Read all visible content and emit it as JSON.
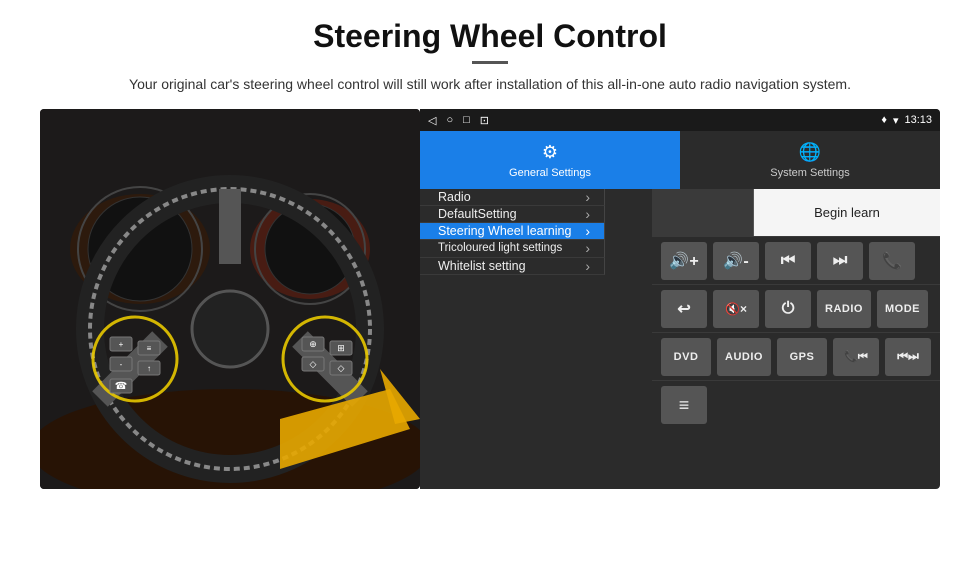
{
  "header": {
    "title": "Steering Wheel Control",
    "subtitle": "Your original car's steering wheel control will still work after installation of this all-in-one auto radio navigation system."
  },
  "status_bar": {
    "nav_icons": [
      "◁",
      "○",
      "□",
      "⊡"
    ],
    "right_icons": "♥ ▾",
    "time": "13:13"
  },
  "tabs": [
    {
      "id": "general",
      "label": "General Settings",
      "icon": "⚙",
      "active": true
    },
    {
      "id": "system",
      "label": "System Settings",
      "icon": "🌐",
      "active": false
    }
  ],
  "menu_items": [
    {
      "id": "radio",
      "label": "Radio",
      "active": false
    },
    {
      "id": "default-setting",
      "label": "DefaultSetting",
      "active": false
    },
    {
      "id": "steering-wheel",
      "label": "Steering Wheel learning",
      "active": true
    },
    {
      "id": "tricoloured",
      "label": "Tricoloured light settings",
      "active": false
    },
    {
      "id": "whitelist",
      "label": "Whitelist setting",
      "active": false
    }
  ],
  "controls": {
    "begin_learn": "Begin learn",
    "row2": [
      {
        "label": "🔊+",
        "type": "icon"
      },
      {
        "label": "🔊-",
        "type": "icon"
      },
      {
        "label": "⏮",
        "type": "icon"
      },
      {
        "label": "⏭",
        "type": "icon"
      },
      {
        "label": "📞",
        "type": "icon"
      }
    ],
    "row3": [
      {
        "label": "↩",
        "type": "icon"
      },
      {
        "label": "🔇×",
        "type": "icon"
      },
      {
        "label": "⏻",
        "type": "icon"
      },
      {
        "label": "RADIO",
        "type": "text"
      },
      {
        "label": "MODE",
        "type": "text"
      }
    ],
    "row4": [
      {
        "label": "DVD",
        "type": "text"
      },
      {
        "label": "AUDIO",
        "type": "text"
      },
      {
        "label": "GPS",
        "type": "text"
      },
      {
        "label": "📞⏮",
        "type": "icon"
      },
      {
        "label": "⏮⏭",
        "type": "icon"
      }
    ],
    "row5_icon": "≡"
  }
}
